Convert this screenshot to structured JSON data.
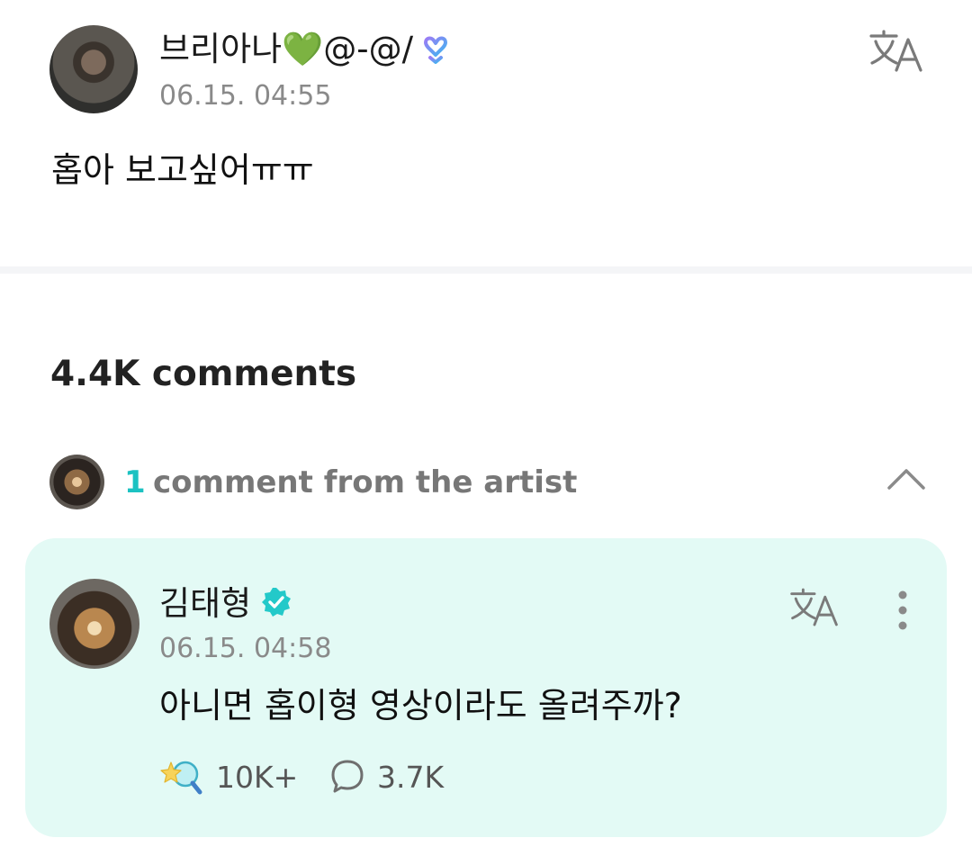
{
  "post": {
    "author": "브리아나💚@-@/",
    "timestamp": "06.15. 04:55",
    "body": "홉아 보고싶어ㅠㅠ",
    "author_badge_icon": "weverse-membership-icon",
    "translate_icon": "translate-icon"
  },
  "comments": {
    "count_label": "4.4K comments",
    "artist_row": {
      "count": "1",
      "label": "comment from the artist",
      "expand_icon": "chevron-up-icon"
    },
    "artist_comment": {
      "author": "김태형",
      "verified_icon": "verified-badge-icon",
      "timestamp": "06.15. 04:58",
      "body": "아니면 홉이형 영상이라도 올려주까?",
      "cheer_count": "10K+",
      "reply_count": "3.7K",
      "background_color": "#e3faf5"
    }
  },
  "colors": {
    "accent_teal": "#1cc2c2",
    "muted_text": "#8a8a8a"
  }
}
